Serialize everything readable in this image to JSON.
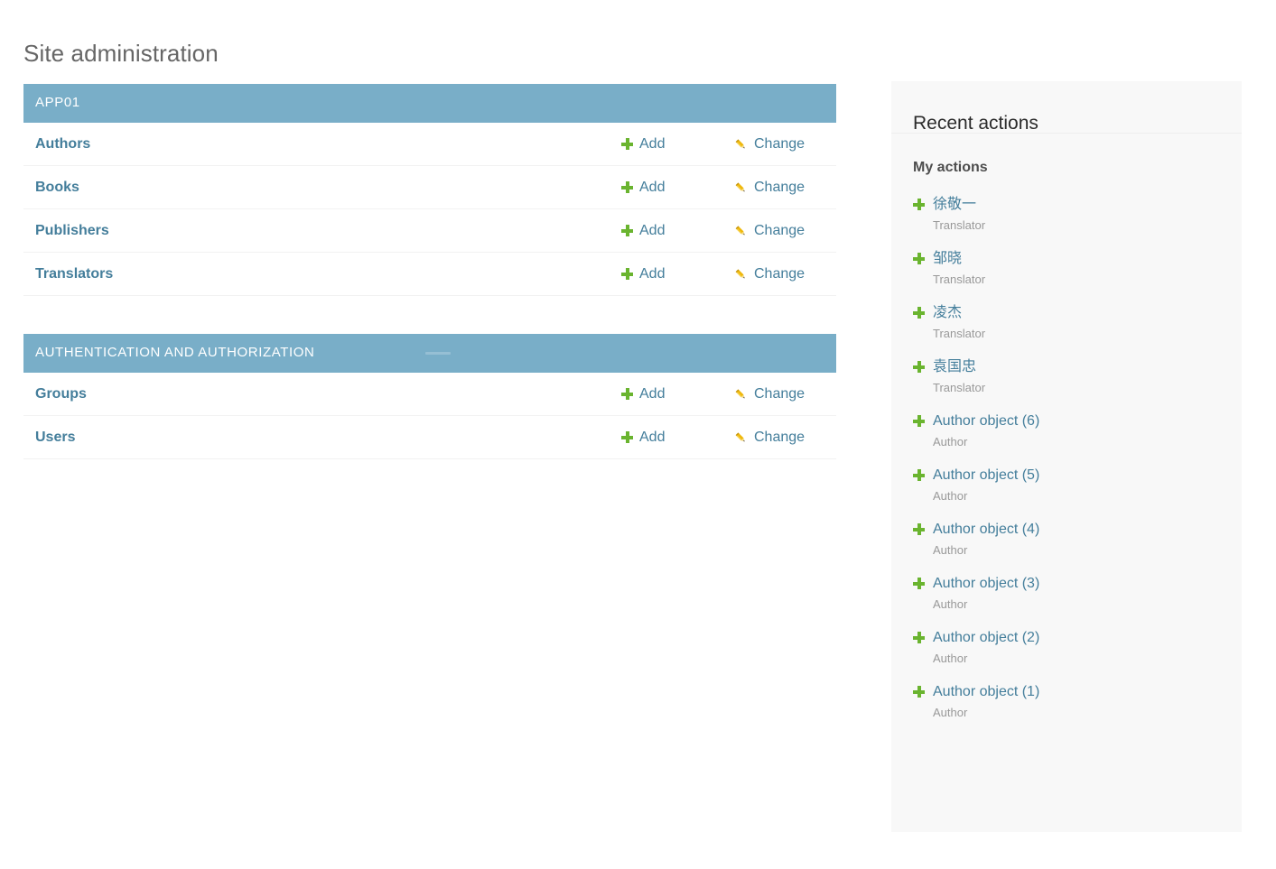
{
  "page": {
    "title": "Site administration",
    "background_color": "#ffffff"
  },
  "colors": {
    "module_header_bg": "#79aec8",
    "link": "#447e9b",
    "add_icon_green": "#6ab42f",
    "change_icon_yellow": "#efb80b",
    "sidebar_bg": "#f8f8f8",
    "muted_text": "#999999",
    "title_text": "#666666"
  },
  "main": {
    "modules": [
      {
        "caption": "APP01",
        "models": [
          {
            "name": "Authors",
            "add_label": "Add",
            "change_label": "Change"
          },
          {
            "name": "Books",
            "add_label": "Add",
            "change_label": "Change"
          },
          {
            "name": "Publishers",
            "add_label": "Add",
            "change_label": "Change"
          },
          {
            "name": "Translators",
            "add_label": "Add",
            "change_label": "Change"
          }
        ]
      },
      {
        "caption": "AUTHENTICATION AND AUTHORIZATION",
        "models": [
          {
            "name": "Groups",
            "add_label": "Add",
            "change_label": "Change"
          },
          {
            "name": "Users",
            "add_label": "Add",
            "change_label": "Change"
          }
        ]
      }
    ]
  },
  "sidebar": {
    "title": "Recent actions",
    "subtitle": "My actions",
    "actions": [
      {
        "object": "徐敬一",
        "type": "Translator",
        "icon": "plus-icon"
      },
      {
        "object": "邹晓",
        "type": "Translator",
        "icon": "plus-icon"
      },
      {
        "object": "凌杰",
        "type": "Translator",
        "icon": "plus-icon"
      },
      {
        "object": "袁国忠",
        "type": "Translator",
        "icon": "plus-icon"
      },
      {
        "object": "Author object (6)",
        "type": "Author",
        "icon": "plus-icon"
      },
      {
        "object": "Author object (5)",
        "type": "Author",
        "icon": "plus-icon"
      },
      {
        "object": "Author object (4)",
        "type": "Author",
        "icon": "plus-icon"
      },
      {
        "object": "Author object (3)",
        "type": "Author",
        "icon": "plus-icon"
      },
      {
        "object": "Author object (2)",
        "type": "Author",
        "icon": "plus-icon"
      },
      {
        "object": "Author object (1)",
        "type": "Author",
        "icon": "plus-icon"
      }
    ]
  }
}
